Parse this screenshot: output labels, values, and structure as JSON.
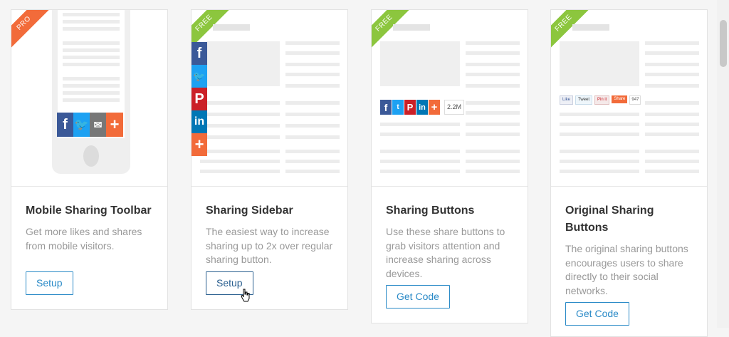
{
  "cards": [
    {
      "badge": "PRO",
      "title": "Mobile Sharing Toolbar",
      "description": "Get more likes and shares from mobile visitors.",
      "button": "Setup"
    },
    {
      "badge": "FREE",
      "title": "Sharing Sidebar",
      "description": "The easiest way to increase sharing up to 2x over regular sharing button.",
      "button": "Setup"
    },
    {
      "badge": "FREE",
      "title": "Sharing Buttons",
      "description": "Use these share buttons to grab visitors attention and increase sharing across devices.",
      "button": "Get Code",
      "share_count": "2.2M"
    },
    {
      "badge": "FREE",
      "title": "Original Sharing Buttons",
      "description": "The original sharing buttons encourages users to share directly to their social networks.",
      "button": "Get Code",
      "mini_buttons": [
        "Like",
        "Tweet",
        "Pin it",
        "Share"
      ],
      "mini_count": "947"
    }
  ],
  "colors": {
    "facebook": "#3b5998",
    "twitter": "#1da1f2",
    "pinterest": "#cb2027",
    "linkedin": "#0077b5",
    "more": "#f26b3a",
    "email": "#777777",
    "accent": "#2a8ac7"
  }
}
